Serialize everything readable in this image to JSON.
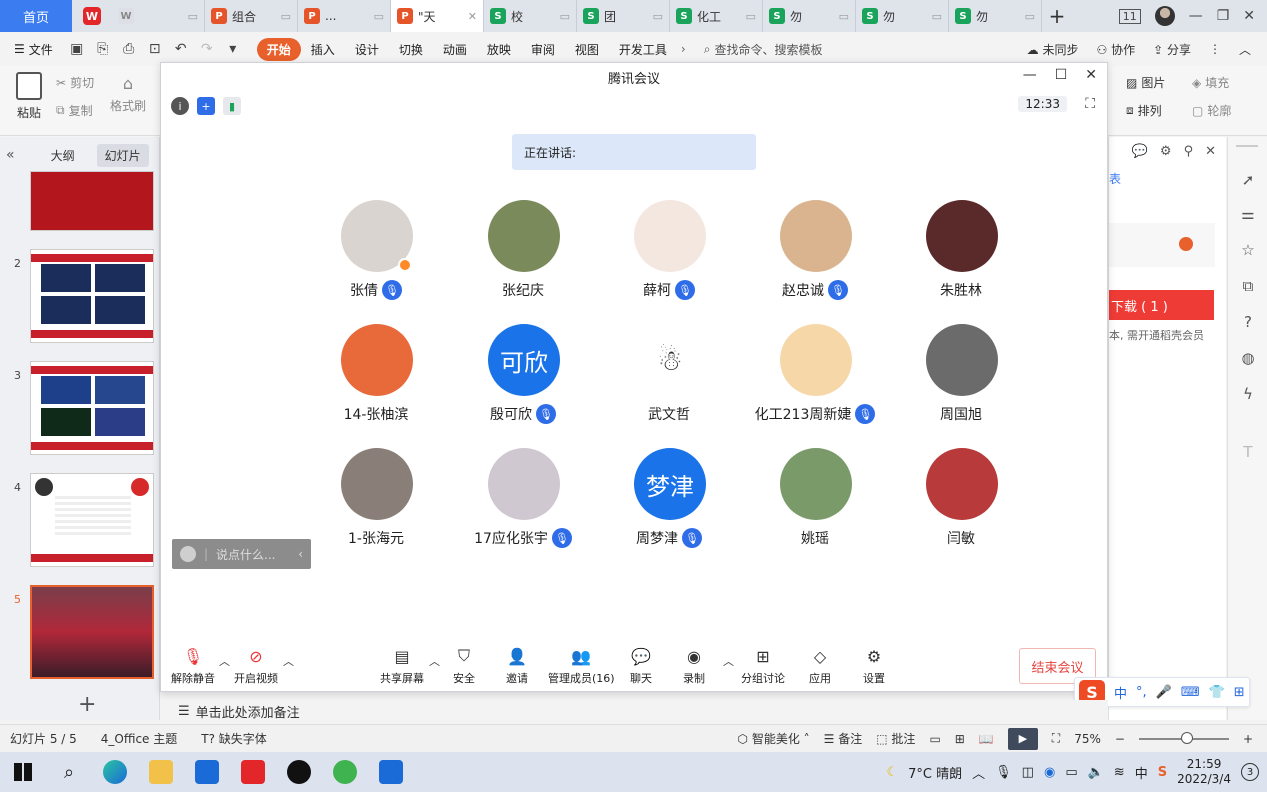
{
  "tabs": {
    "home": "首页",
    "items": [
      {
        "icon": "W",
        "kind": "w",
        "label": "",
        "extra": ""
      },
      {
        "icon": "P",
        "kind": "p",
        "label": "组合",
        "extra": ""
      },
      {
        "icon": "P",
        "kind": "p",
        "label": "...",
        "extra": ""
      },
      {
        "icon": "P",
        "kind": "p",
        "label": "\"天",
        "extra": "✕"
      },
      {
        "icon": "S",
        "kind": "s",
        "label": "校",
        "extra": ""
      },
      {
        "icon": "S",
        "kind": "s",
        "label": "团",
        "extra": ""
      },
      {
        "icon": "S",
        "kind": "s",
        "label": "化工",
        "extra": ""
      },
      {
        "icon": "S",
        "kind": "s",
        "label": "勿",
        "extra": ""
      },
      {
        "icon": "S",
        "kind": "s",
        "label": "勿",
        "extra": ""
      },
      {
        "icon": "S",
        "kind": "s",
        "label": "勿",
        "extra": ""
      }
    ],
    "add": "+",
    "badge": "11"
  },
  "menu": {
    "file": "文件",
    "items": [
      "开始",
      "插入",
      "设计",
      "切换",
      "动画",
      "放映",
      "审阅",
      "视图",
      "开发工具"
    ],
    "search": "查找命令、搜索模板",
    "sync": "未同步",
    "collab": "协作",
    "share": "分享"
  },
  "ribbon": {
    "paste": "粘贴",
    "cut": "剪切",
    "copy": "复制",
    "format_painter": "格式刷",
    "picture": "图片",
    "fill": "填充",
    "arrange": "排列",
    "outline": "轮廓"
  },
  "leftpanel": {
    "tab_outline": "大纲",
    "tab_slides": "幻灯片",
    "slide_numbers": [
      "2",
      "3",
      "4",
      "5"
    ]
  },
  "meeting": {
    "title": "腾讯会议",
    "time": "12:33",
    "speaking": "正在讲话:",
    "chat_placeholder": "说点什么...",
    "participants": [
      {
        "name": "张倩",
        "mic": true,
        "avatar_text": "",
        "avatar_color": "#d9d4cf"
      },
      {
        "name": "张纪庆",
        "mic": false,
        "avatar_text": "",
        "avatar_color": "#7a8a5a"
      },
      {
        "name": "薛柯",
        "mic": true,
        "avatar_text": "",
        "avatar_color": "#f3e7e0"
      },
      {
        "name": "赵忠诚",
        "mic": true,
        "avatar_text": "",
        "avatar_color": "#d9b48f"
      },
      {
        "name": "朱胜林",
        "mic": false,
        "avatar_text": "",
        "avatar_color": "#5a2a2a"
      },
      {
        "name": "14-张柚滨",
        "mic": false,
        "avatar_text": "",
        "avatar_color": "#e86a3a"
      },
      {
        "name": "殷可欣",
        "mic": true,
        "avatar_text": "可欣",
        "avatar_color": "#1a73e8"
      },
      {
        "name": "武文哲",
        "mic": false,
        "avatar_text": "",
        "avatar_color": "#ffffff"
      },
      {
        "name": "化工213周新婕",
        "mic": true,
        "avatar_text": "",
        "avatar_color": "#f5d7a8"
      },
      {
        "name": "周国旭",
        "mic": false,
        "avatar_text": "",
        "avatar_color": "#6b6b6b"
      },
      {
        "name": "1-张海元",
        "mic": false,
        "avatar_text": "",
        "avatar_color": "#8a7f78"
      },
      {
        "name": "17应化张宇",
        "mic": true,
        "avatar_text": "",
        "avatar_color": "#cfc8d0"
      },
      {
        "name": "周梦津",
        "mic": true,
        "avatar_text": "梦津",
        "avatar_color": "#1a73e8"
      },
      {
        "name": "姚瑶",
        "mic": false,
        "avatar_text": "",
        "avatar_color": "#7a9a6a"
      },
      {
        "name": "闫敏",
        "mic": false,
        "avatar_text": "",
        "avatar_color": "#b83a3a"
      }
    ],
    "bottom": {
      "unmute": "解除静音",
      "video": "开启视频",
      "share": "共享屏幕",
      "security": "安全",
      "invite": "邀请",
      "members": "管理成员(16)",
      "chat": "聊天",
      "record": "录制",
      "breakout": "分组讨论",
      "apps": "应用",
      "settings": "设置",
      "end": "结束会议"
    }
  },
  "rightpanel": {
    "blue_text": "表",
    "download": "下载 ( 1 )",
    "tip": "本, 需开通稻壳会员"
  },
  "notes": "单击此处添加备注",
  "status": {
    "slide": "幻灯片 5 / 5",
    "theme": "4_Office 主题",
    "missing_font": "缺失字体",
    "beautify": "智能美化",
    "notes": "备注",
    "comments": "批注",
    "zoom": "75%"
  },
  "ime": {
    "logo": "S",
    "lang": "中",
    "punct": "°,"
  },
  "taskbar": {
    "weather": "7°C 晴朗",
    "time": "21:59",
    "date": "2022/3/4",
    "ime_lang": "中",
    "notifications": "3"
  }
}
